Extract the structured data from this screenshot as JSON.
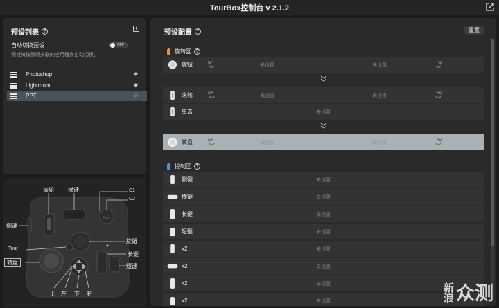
{
  "window": {
    "title": "TourBox控制台 v 2.1.2"
  },
  "preset_list": {
    "title": "预设列表",
    "auto_switch_label": "自动切换预设",
    "auto_switch_toggle": "OFF",
    "auto_switch_desc": "预设将按照所关联的应用程序自动切换。",
    "items": [
      {
        "label": "Photoshop",
        "active": false
      },
      {
        "label": "Lightroom",
        "active": false
      },
      {
        "label": "PPT",
        "active": true
      }
    ]
  },
  "device": {
    "labels": {
      "scroll": "滚轮",
      "knob_tall": "横键",
      "c1": "C1",
      "c2": "C2",
      "side": "侧键",
      "knob": "旋钮",
      "tour": "Tour",
      "tall": "长键",
      "dial": "转盘",
      "short": "短键",
      "up": "上",
      "left": "左",
      "down": "下",
      "right": "右"
    }
  },
  "config": {
    "title": "预设配置",
    "reset_label": "重置",
    "rotate_section": "旋转区",
    "control_section": "控制区",
    "rotate_rows": [
      {
        "name": "旋钮",
        "left": "未设置",
        "right": "未设置"
      },
      {
        "name": "滚轮",
        "left": "未设置",
        "right": "未设置"
      },
      {
        "name": "单击",
        "center": "未设置"
      },
      {
        "name": "转盘",
        "left": "未设置",
        "right": "未设置"
      }
    ],
    "control_rows": [
      {
        "name": "侧键",
        "value": "未设置"
      },
      {
        "name": "横键",
        "value": "未设置"
      },
      {
        "name": "长键",
        "value": "未设置"
      },
      {
        "name": "短键",
        "value": "未设置"
      },
      {
        "name": "x2",
        "value": "未设置"
      },
      {
        "name": "x2",
        "value": "未设置"
      },
      {
        "name": "x2",
        "value": "未设置"
      },
      {
        "name": "x2",
        "value": "未设置"
      }
    ],
    "accent_colors": {
      "rotate": "#e3944c",
      "control": "#5b8fd6",
      "highlight_row": "#aab1b5"
    }
  },
  "watermark": {
    "line1_a": "新",
    "line1_b": "浪",
    "line2": "众测"
  }
}
